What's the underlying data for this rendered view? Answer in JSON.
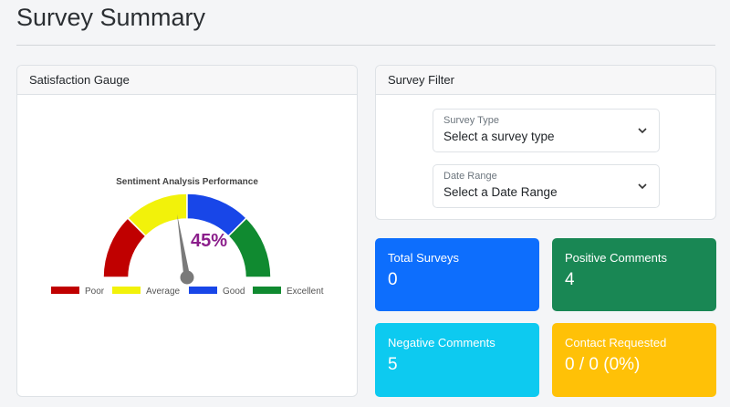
{
  "page": {
    "title": "Survey Summary"
  },
  "gauge_card": {
    "header": "Satisfaction Gauge",
    "chart_title": "Sentiment Analysis Performance",
    "value_label": "45%"
  },
  "chart_data": {
    "type": "gauge",
    "title": "Sentiment Analysis Performance",
    "value": 45,
    "min": 0,
    "max": 100,
    "segments": [
      {
        "name": "Poor",
        "color": "#c00000",
        "from": 0,
        "to": 25
      },
      {
        "name": "Average",
        "color": "#f2f20a",
        "from": 25,
        "to": 50
      },
      {
        "name": "Good",
        "color": "#1846e8",
        "from": 50,
        "to": 75
      },
      {
        "name": "Excellent",
        "color": "#108a30",
        "from": 75,
        "to": 100
      }
    ],
    "needle_color": "#7a7a7a",
    "value_color": "#8b1e8b",
    "legend_position": "bottom"
  },
  "filter_card": {
    "header": "Survey Filter",
    "survey_type": {
      "label": "Survey Type",
      "value": "Select a survey type"
    },
    "date_range": {
      "label": "Date Range",
      "value": "Select a Date Range"
    }
  },
  "stats": {
    "total": {
      "label": "Total Surveys",
      "value": "0",
      "color": "#0d6efd"
    },
    "positive": {
      "label": "Positive Comments",
      "value": "4",
      "color": "#198754"
    },
    "negative": {
      "label": "Negative Comments",
      "value": "5",
      "color": "#0dcaf0"
    },
    "contact": {
      "label": "Contact Requested",
      "value": "0 / 0 (0%)",
      "color": "#ffc107"
    }
  }
}
